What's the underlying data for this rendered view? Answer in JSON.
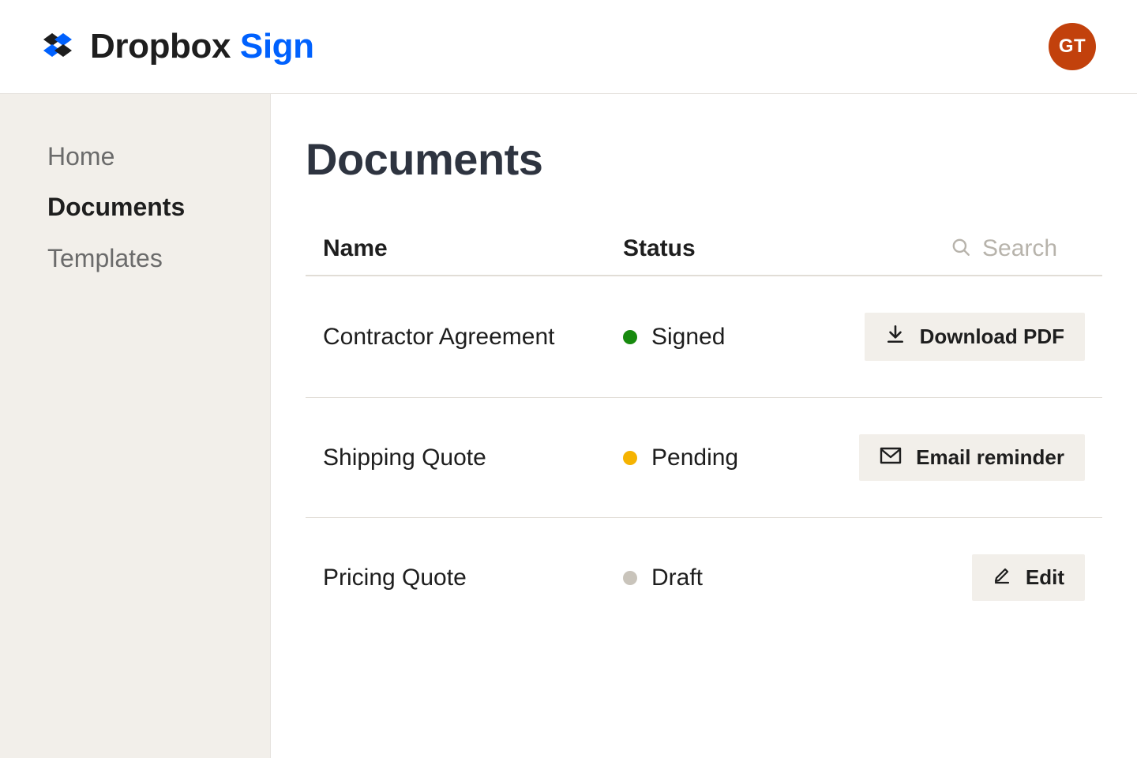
{
  "header": {
    "brand_primary": "Dropbox ",
    "brand_secondary": "Sign",
    "avatar_initials": "GT"
  },
  "sidebar": {
    "items": [
      {
        "label": "Home",
        "active": false
      },
      {
        "label": "Documents",
        "active": true
      },
      {
        "label": "Templates",
        "active": false
      }
    ]
  },
  "main": {
    "title": "Documents",
    "columns": {
      "name": "Name",
      "status": "Status"
    },
    "search_placeholder": "Search",
    "rows": [
      {
        "name": "Contractor Agreement",
        "status_label": "Signed",
        "status_color": "#178a0e",
        "action_label": "Download PDF",
        "action_icon": "download"
      },
      {
        "name": "Shipping Quote",
        "status_label": "Pending",
        "status_color": "#f5b301",
        "action_label": "Email reminder",
        "action_icon": "mail"
      },
      {
        "name": "Pricing Quote",
        "status_label": "Draft",
        "status_color": "#c9c4bb",
        "action_label": "Edit",
        "action_icon": "pencil"
      }
    ]
  },
  "colors": {
    "accent_blue": "#0061fe",
    "avatar_bg": "#c2410c",
    "sidebar_bg": "#f2efea"
  }
}
